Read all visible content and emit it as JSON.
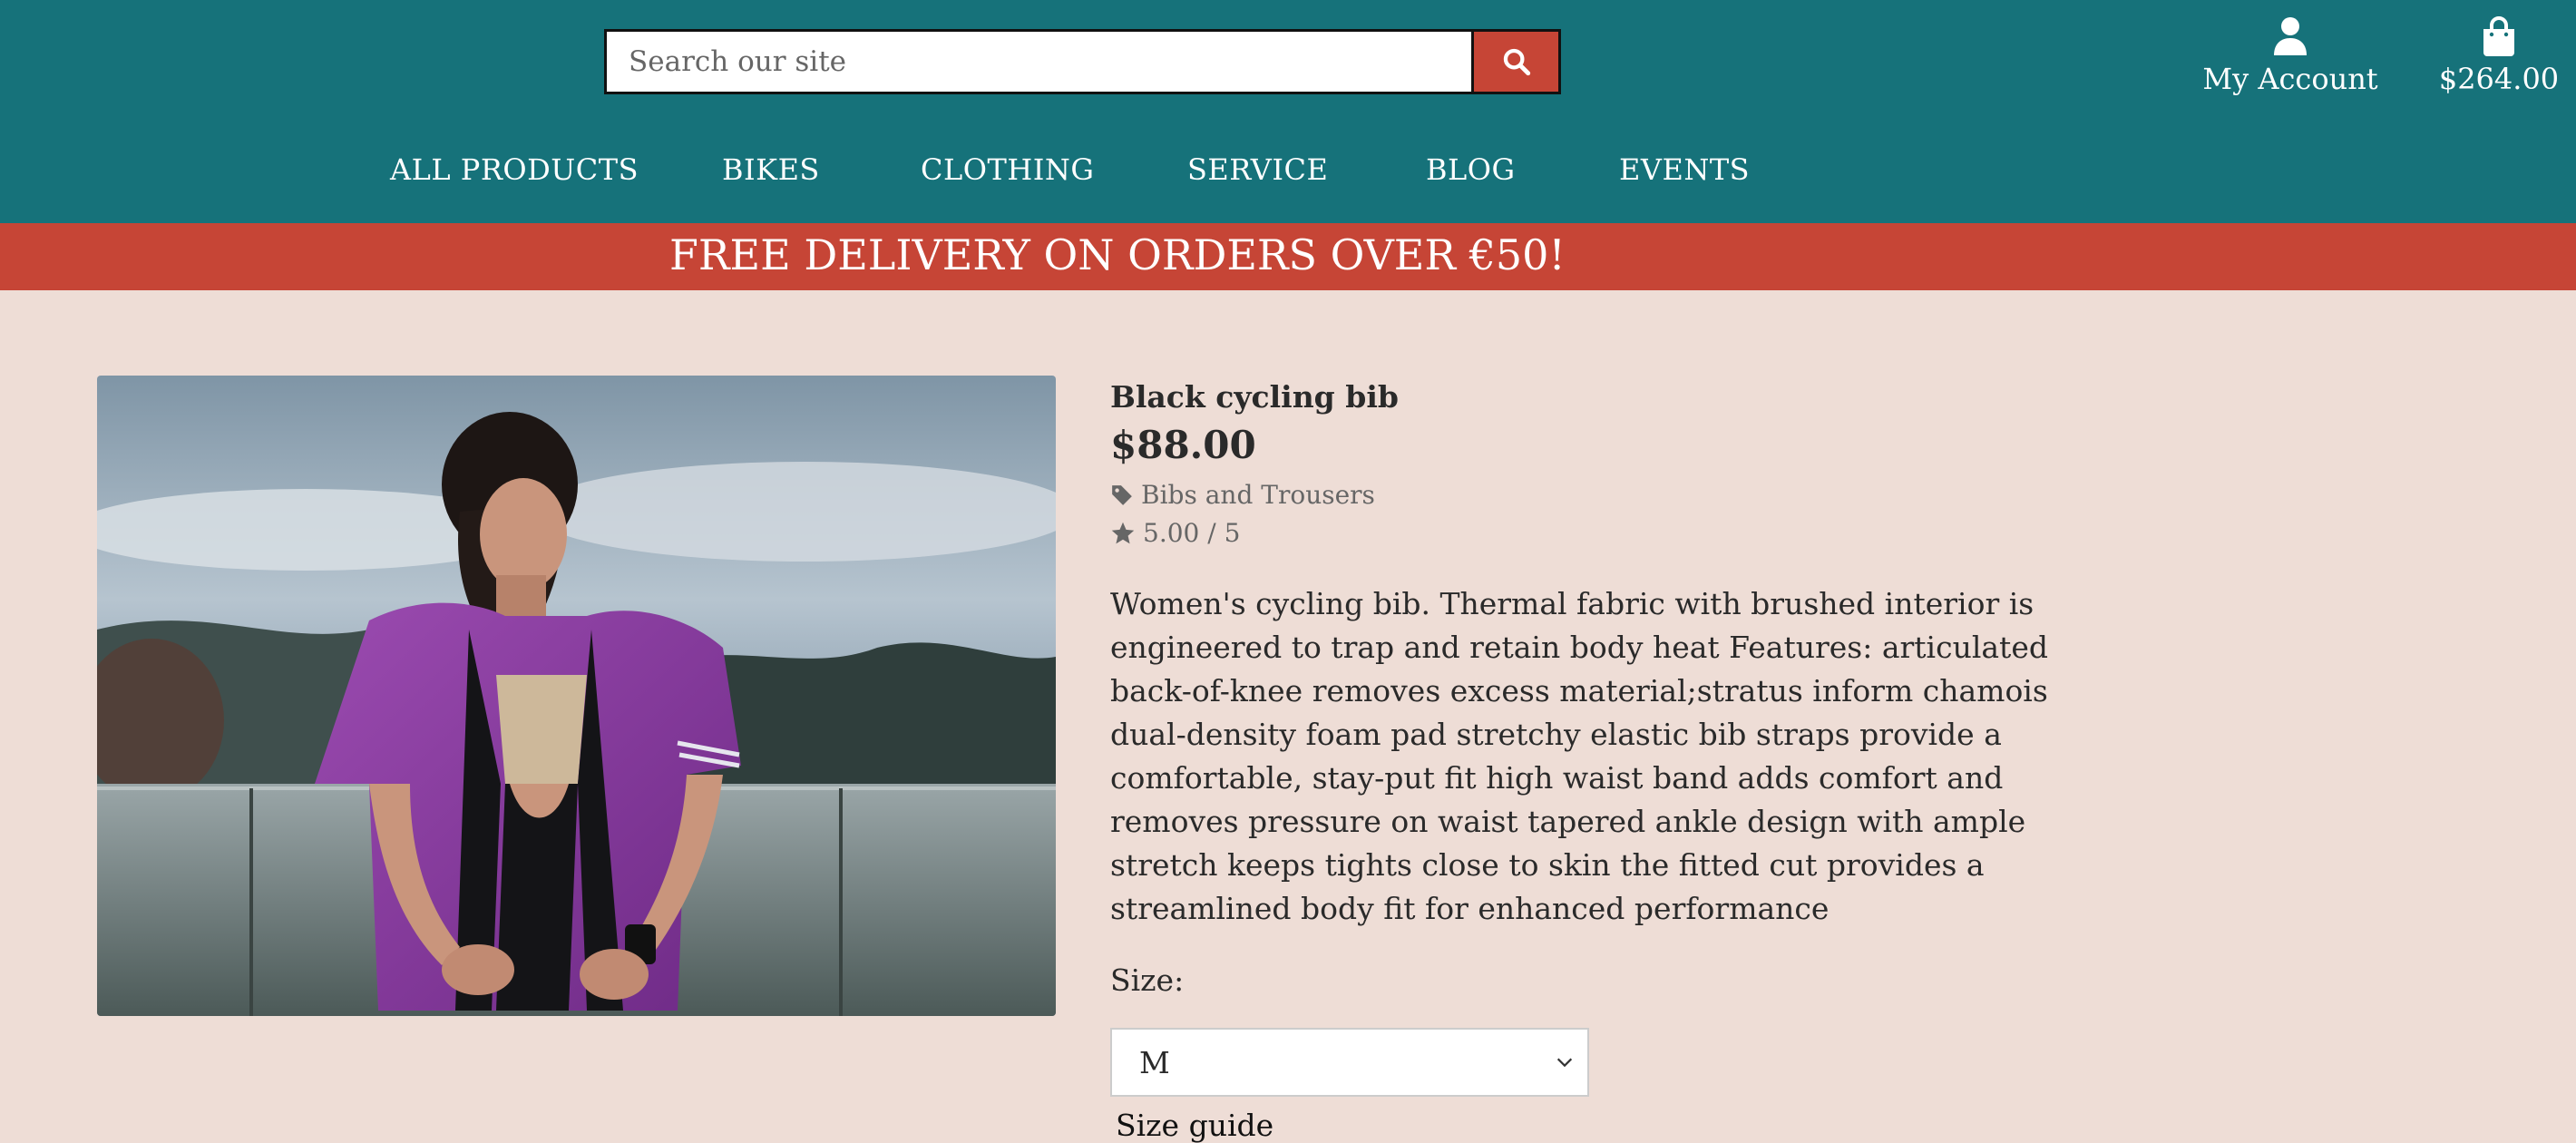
{
  "header": {
    "search": {
      "placeholder": "Search our site",
      "button_icon": "search-icon"
    },
    "account": {
      "icon": "user-icon",
      "label": "My Account"
    },
    "cart": {
      "icon": "shopping-bag-icon",
      "total": "$264.00"
    },
    "nav": [
      {
        "label": "ALL PRODUCTS"
      },
      {
        "label": "BIKES"
      },
      {
        "label": "CLOTHING"
      },
      {
        "label": "SERVICE"
      },
      {
        "label": "BLOG"
      },
      {
        "label": "EVENTS"
      }
    ]
  },
  "banner": {
    "text": "FREE DELIVERY ON ORDERS OVER €50!"
  },
  "product": {
    "name": "Black cycling bib",
    "price": "$88.00",
    "category": "Bibs and Trousers",
    "category_icon": "tag-icon",
    "rating": "5.00 / 5",
    "rating_icon": "star-icon",
    "description": "Women's cycling bib. Thermal fabric with brushed interior is engineered to trap and retain body heat Features: articulated back-of-knee removes excess material;stratus inform chamois dual-density foam pad stretchy elastic bib straps provide a comfortable, stay-put fit high waist band adds comfort and removes pressure on waist tapered ankle design with ample stretch keeps tights close to skin the fitted cut provides a streamlined body fit for enhanced performance",
    "size_label": "Size:",
    "size_selected": "M",
    "size_guide": "Size guide"
  },
  "colors": {
    "header_bg": "#16727a",
    "accent": "#c64536",
    "page_bg": "#eeddd6"
  }
}
